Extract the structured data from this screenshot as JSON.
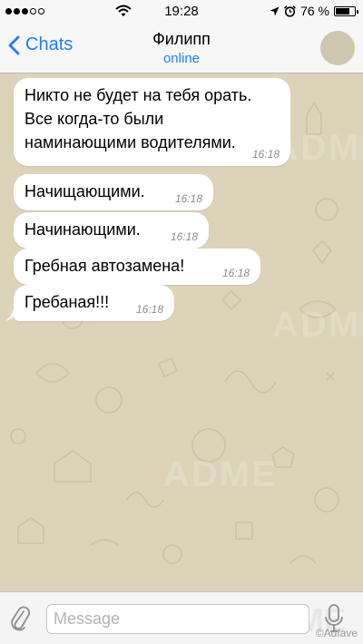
{
  "status_bar": {
    "signal_bars": 5,
    "signal_filled": 3,
    "time": "19:28",
    "battery_percent": "76 %",
    "battery_level": 0.76
  },
  "nav": {
    "back_label": "Chats",
    "contact_name": "Филипп",
    "contact_status": "online"
  },
  "messages": [
    {
      "text": "Никто не будет на тебя орать.\nВсе когда-то были\nнаминающими водителями.",
      "time": "16:18"
    },
    {
      "text": "Начищающими.",
      "time": "16:18"
    },
    {
      "text": "Начинающими.",
      "time": "16:18"
    },
    {
      "text": "Гребная автозамена!",
      "time": "16:18"
    },
    {
      "text": "Гребаная!!!",
      "time": "16:18"
    }
  ],
  "watermark": "ADME",
  "input": {
    "placeholder": "Message",
    "value": ""
  },
  "credit": "©Adfave",
  "colors": {
    "accent": "#1f7ef5",
    "chat_background": "#dcd3b9",
    "bubble": "#ffffff",
    "timestamp": "#8d8d8d"
  },
  "icons": {
    "signal": "signal-dots-icon",
    "wifi": "wifi-icon",
    "location": "location-arrow-icon",
    "alarm": "alarm-clock-icon",
    "battery": "battery-icon",
    "back": "chevron-left-icon",
    "attach": "paperclip-icon",
    "mic": "microphone-icon"
  }
}
